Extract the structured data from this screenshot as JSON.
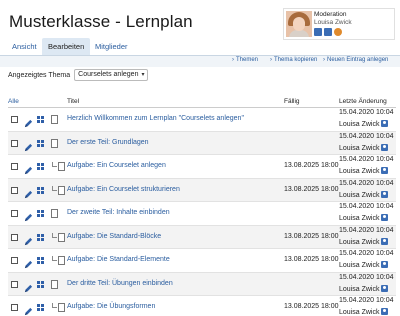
{
  "page": {
    "title": "Musterklasse - Lernplan"
  },
  "moderation": {
    "role": "Moderation",
    "name": "Louisa Zwick"
  },
  "tabs": [
    {
      "label": "Ansicht"
    },
    {
      "label": "Bearbeiten",
      "active": true
    },
    {
      "label": "Mitglieder"
    }
  ],
  "actions": [
    {
      "label": "Themen"
    },
    {
      "label": "Thema kopieren"
    },
    {
      "label": "Neuen Eintrag anlegen"
    }
  ],
  "filter": {
    "label": "Angezeigtes Thema",
    "value": "Courselets anlegen"
  },
  "table": {
    "headers": {
      "select_all": "Alle",
      "title": "Titel",
      "due": "Fällig",
      "changed": "Letzte Änderung"
    },
    "rows": [
      {
        "title": "Herzlich Willkommen zum Lernplan \"Courselets anlegen\"",
        "due": "",
        "date": "15.04.2020 10:04",
        "user": "Louisa Zwick",
        "sub": false
      },
      {
        "title": "Der erste Teil: Grundlagen",
        "due": "",
        "date": "15.04.2020 10:04",
        "user": "Louisa Zwick",
        "sub": false
      },
      {
        "title": "Aufgabe: Ein Courselet anlegen",
        "due": "13.08.2025 18:00",
        "date": "15.04.2020 10:04",
        "user": "Louisa Zwick",
        "sub": true
      },
      {
        "title": "Aufgabe: Ein Courselet strukturieren",
        "due": "13.08.2025 18:00",
        "date": "15.04.2020 10:04",
        "user": "Louisa Zwick",
        "sub": true
      },
      {
        "title": "Der zweite Teil: Inhalte einbinden",
        "due": "",
        "date": "15.04.2020 10:04",
        "user": "Louisa Zwick",
        "sub": false
      },
      {
        "title": "Aufgabe: Die Standard-Blöcke",
        "due": "13.08.2025 18:00",
        "date": "15.04.2020 10:04",
        "user": "Louisa Zwick",
        "sub": true
      },
      {
        "title": "Aufgabe: Die Standard-Elemente",
        "due": "13.08.2025 18:00",
        "date": "15.04.2020 10:04",
        "user": "Louisa Zwick",
        "sub": true
      },
      {
        "title": "Der dritte Teil: Übungen einbinden",
        "due": "",
        "date": "15.04.2020 10:04",
        "user": "Louisa Zwick",
        "sub": false
      },
      {
        "title": "Aufgabe: Die Übungsformen",
        "due": "13.08.2025 18:00",
        "date": "15.04.2020 10:04",
        "user": "Louisa Zwick",
        "sub": true
      }
    ]
  },
  "colors": {
    "link": "#2a5d9f",
    "tab_active_bg": "#dde8f3",
    "icon_blue": "#2f5fa8"
  }
}
